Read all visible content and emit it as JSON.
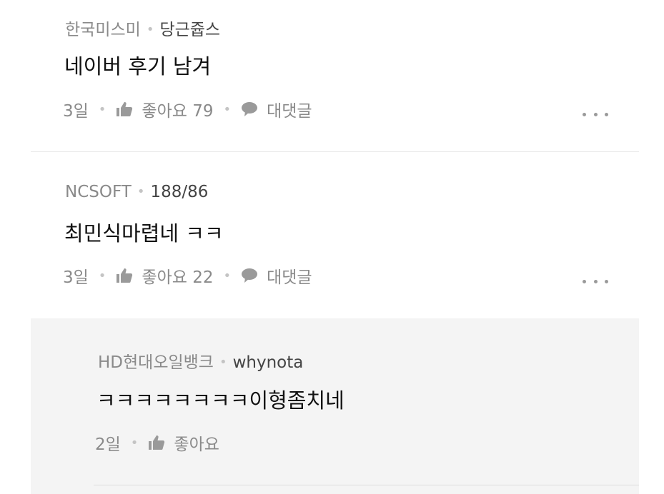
{
  "comments": [
    {
      "company": "한국미스미",
      "nickname": "당근쥽스",
      "text": "네이버 후기 남겨",
      "age": "3일",
      "like_label": "좋아요 79",
      "reply_label": "대댓글"
    },
    {
      "company": "NCSOFT",
      "nickname": "188/86",
      "text": "최민식마렵네 ㅋㅋ",
      "age": "3일",
      "like_label": "좋아요 22",
      "reply_label": "대댓글"
    }
  ],
  "reply": {
    "company": "HD현대오일뱅크",
    "nickname": "whynota",
    "text": "ㅋㅋㅋㅋㅋㅋㅋㅋ이형좀치네",
    "age": "2일",
    "like_label": "좋아요"
  },
  "icons": {
    "like": "thumbs-up-icon",
    "reply": "speech-bubble-icon",
    "more": "more-dots-icon"
  },
  "colors": {
    "meta_text": "#8a8a8a",
    "nickname": "#444444",
    "body_text": "#111111",
    "reply_background": "#f4f4f4"
  }
}
